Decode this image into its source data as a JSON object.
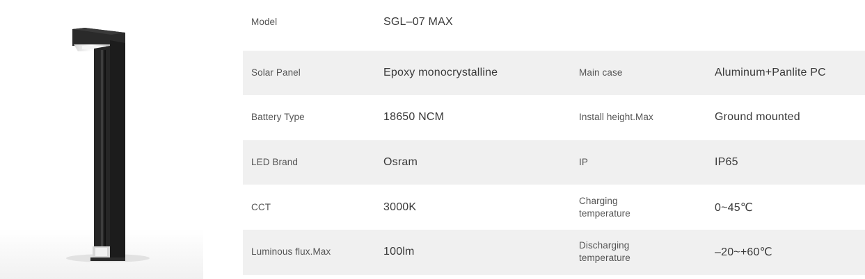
{
  "colors": {
    "stripe": "#f0f0f0",
    "label": "#555555",
    "value": "#3a3a3a",
    "product": "#1e1e1e"
  },
  "product_image": {
    "icon": "bollard-light-image"
  },
  "specs": {
    "rows": [
      {
        "label1": "Model",
        "value1": "SGL–07 MAX"
      },
      {
        "label1": "Solar Panel",
        "value1": "Epoxy monocrystalline",
        "label2": "Main case",
        "value2": "Aluminum+Panlite PC"
      },
      {
        "label1": "Battery Type",
        "value1": "18650 NCM",
        "label2": "Install height.Max",
        "value2": "Ground mounted"
      },
      {
        "label1": "LED Brand",
        "value1": "Osram",
        "label2": "IP",
        "value2": "IP65"
      },
      {
        "label1": "CCT",
        "value1": "3000K",
        "label2": "Charging temperature",
        "value2": "0~45℃"
      },
      {
        "label1": "Luminous flux.Max",
        "value1": "100lm",
        "label2": "Discharging temperature",
        "value2": "–20~+60℃"
      }
    ]
  }
}
